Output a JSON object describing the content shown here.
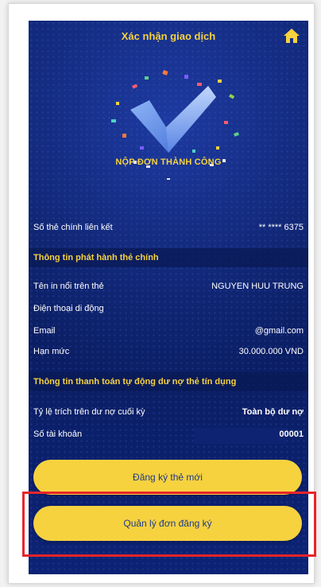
{
  "header": {
    "title": "Xác nhận giao dịch",
    "home_icon": "home-icon"
  },
  "status": {
    "message": "NỘP ĐƠN THÀNH CÔNG"
  },
  "linked_card": {
    "label": "Số thẻ chính liên kết",
    "value": "** **** 6375"
  },
  "issue_section": {
    "title": "Thông tin phát hành thẻ chính",
    "rows": [
      {
        "label": "Tên in nổi trên thẻ",
        "value": "NGUYEN HUU TRUNG"
      },
      {
        "label": "Điện thoại di động",
        "value": ""
      },
      {
        "label": "Email",
        "value": "@gmail.com"
      },
      {
        "label": "Hạn mức",
        "value": "30.000.000 VND"
      }
    ]
  },
  "payment_section": {
    "title": "Thông tin thanh toán tự động dư nợ thẻ tín dụng",
    "rows": [
      {
        "label": "Tỷ lệ trích trên dư nợ cuối kỳ",
        "value": "Toàn bộ dư nợ"
      },
      {
        "label": "Số tài khoản",
        "value": "00001"
      }
    ]
  },
  "buttons": {
    "register_new": "Đăng ký thẻ mới",
    "manage": "Quản lý đơn đăng ký"
  },
  "colors": {
    "accent": "#f6d23f",
    "background": "#0b1f66",
    "button_text": "#1f3a8a",
    "highlight": "#e8242a"
  }
}
